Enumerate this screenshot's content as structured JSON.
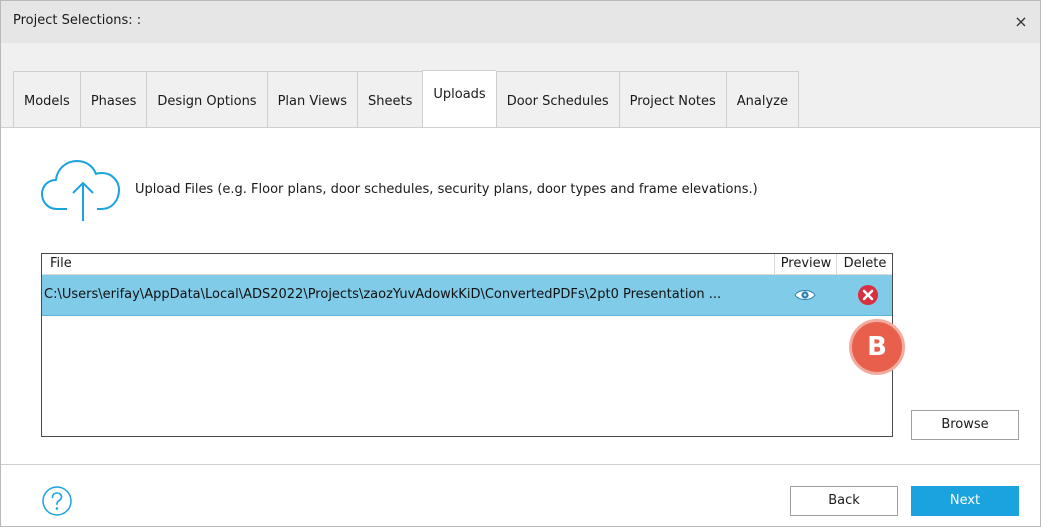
{
  "window": {
    "title": "Project Selections: :",
    "close_glyph": "×"
  },
  "tabs": [
    {
      "label": "Models",
      "active": false
    },
    {
      "label": "Phases",
      "active": false
    },
    {
      "label": "Design Options",
      "active": false
    },
    {
      "label": "Plan Views",
      "active": false
    },
    {
      "label": "Sheets",
      "active": false
    },
    {
      "label": "Uploads",
      "active": true
    },
    {
      "label": "Door Schedules",
      "active": false
    },
    {
      "label": "Project Notes",
      "active": false
    },
    {
      "label": "Analyze",
      "active": false
    }
  ],
  "upload": {
    "icon": "cloud-upload-icon",
    "hint": "Upload Files (e.g. Floor plans, door schedules, security plans, door types and frame elevations.)"
  },
  "table": {
    "columns": {
      "file": "File",
      "preview": "Preview",
      "delete": "Delete"
    },
    "rows": [
      {
        "path": "C:\\Users\\erifay\\AppData\\Local\\ADS2022\\Projects\\zaozYuvAdowkKiD\\ConvertedPDFs\\2pt0 Presentation ...",
        "preview_icon": "eye-icon",
        "delete_icon": "delete-x-icon"
      }
    ]
  },
  "callout": {
    "label": "B"
  },
  "buttons": {
    "browse": "Browse",
    "back": "Back",
    "next": "Next"
  },
  "colors": {
    "accent": "#1aa3df",
    "row_selected": "#7fcbe8",
    "delete_red": "#d9303f",
    "callout": "#e8604c"
  }
}
